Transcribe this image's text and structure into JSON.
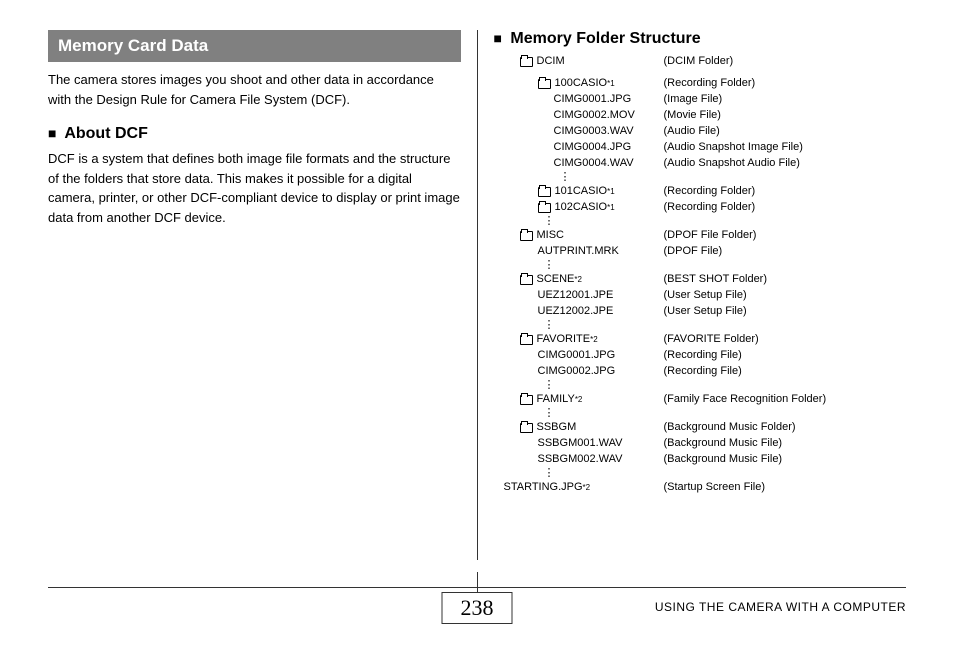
{
  "left": {
    "banner": "Memory Card Data",
    "intro": "The camera stores images you shoot and other data in accordance with the Design Rule for Camera File System (DCF).",
    "sub1_bullet": "■",
    "sub1": "About DCF",
    "sub1_body": "DCF is a system that defines both image file formats and the structure of the folders that store data. This makes it possible for a digital camera, printer, or other DCF-compliant device to display or print image data from another DCF device."
  },
  "right": {
    "sub_bullet": "■",
    "sub": "Memory Folder Structure",
    "tree": [
      {
        "indent": 1,
        "folder": true,
        "name": "DCIM",
        "sup": "",
        "desc": "(DCIM Folder)"
      },
      {
        "spacer": true
      },
      {
        "indent": 2,
        "folder": true,
        "name": "100CASIO",
        "sup": "*1",
        "desc": "(Recording Folder)"
      },
      {
        "indent": 3,
        "folder": false,
        "name": "CIMG0001.JPG",
        "sup": "",
        "desc": "(Image File)"
      },
      {
        "indent": 3,
        "folder": false,
        "name": "CIMG0002.MOV",
        "sup": "",
        "desc": "(Movie File)"
      },
      {
        "indent": 3,
        "folder": false,
        "name": "CIMG0003.WAV",
        "sup": "",
        "desc": "(Audio File)"
      },
      {
        "indent": 3,
        "folder": false,
        "name": "CIMG0004.JPG",
        "sup": "",
        "desc": "(Audio Snapshot Image File)"
      },
      {
        "indent": 3,
        "folder": false,
        "name": "CIMG0004.WAV",
        "sup": "",
        "desc": "(Audio Snapshot Audio File)"
      },
      {
        "vdots": 3
      },
      {
        "indent": 2,
        "folder": true,
        "name": "101CASIO",
        "sup": "*1",
        "desc": "(Recording Folder)"
      },
      {
        "indent": 2,
        "folder": true,
        "name": "102CASIO",
        "sup": "*1",
        "desc": "(Recording Folder)"
      },
      {
        "vdots": 2
      },
      {
        "indent": 1,
        "folder": true,
        "name": "MISC",
        "sup": "",
        "desc": "(DPOF File Folder)"
      },
      {
        "indent": 2,
        "folder": false,
        "name": "AUTPRINT.MRK",
        "sup": "",
        "desc": "(DPOF File)"
      },
      {
        "vdots": 2
      },
      {
        "indent": 1,
        "folder": true,
        "name": "SCENE",
        "sup": "*2",
        "desc": "(BEST SHOT Folder)"
      },
      {
        "indent": 2,
        "folder": false,
        "name": "UEZ12001.JPE",
        "sup": "",
        "desc": "(User Setup File)"
      },
      {
        "indent": 2,
        "folder": false,
        "name": "UEZ12002.JPE",
        "sup": "",
        "desc": "(User Setup File)"
      },
      {
        "vdots": 2
      },
      {
        "indent": 1,
        "folder": true,
        "name": "FAVORITE",
        "sup": "*2",
        "desc": "(FAVORITE Folder)"
      },
      {
        "indent": 2,
        "folder": false,
        "name": "CIMG0001.JPG",
        "sup": "",
        "desc": "(Recording File)"
      },
      {
        "indent": 2,
        "folder": false,
        "name": "CIMG0002.JPG",
        "sup": "",
        "desc": "(Recording File)"
      },
      {
        "vdots": 2
      },
      {
        "indent": 1,
        "folder": true,
        "name": "FAMILY",
        "sup": "*2",
        "desc": "(Family Face Recognition Folder)"
      },
      {
        "vdots": 2
      },
      {
        "indent": 1,
        "folder": true,
        "name": "SSBGM",
        "sup": "",
        "desc": "(Background Music Folder)"
      },
      {
        "indent": 2,
        "folder": false,
        "name": "SSBGM001.WAV",
        "sup": "",
        "desc": "(Background Music File)"
      },
      {
        "indent": 2,
        "folder": false,
        "name": "SSBGM002.WAV",
        "sup": "",
        "desc": "(Background Music File)"
      },
      {
        "vdots": 2
      },
      {
        "indent": 0,
        "folder": false,
        "name": "STARTING.JPG",
        "sup": "*2",
        "desc": "(Startup Screen File)"
      }
    ]
  },
  "footer": {
    "page": "238",
    "text": "USING THE CAMERA WITH A COMPUTER"
  }
}
